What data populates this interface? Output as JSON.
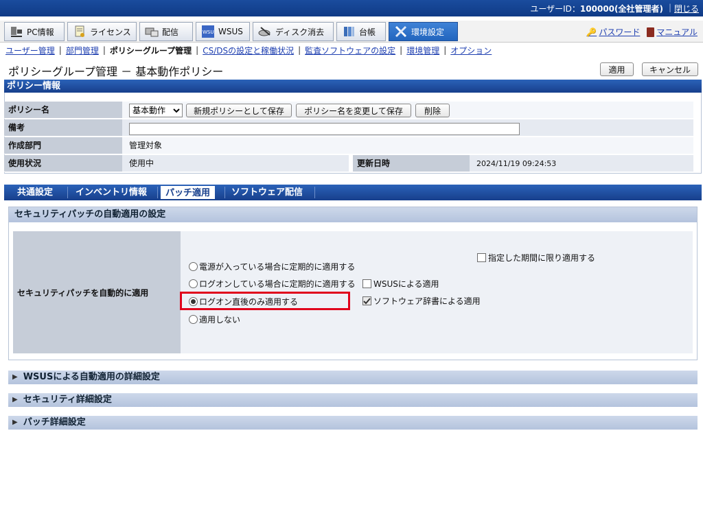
{
  "topbar": {
    "user_label": "ユーザーID：",
    "user_value": "100000(全社管理者)",
    "separator": "|",
    "logout": "閉じる"
  },
  "menu": {
    "tabs": [
      {
        "label": "PC情報",
        "icon": "pc-icon"
      },
      {
        "label": "ライセンス",
        "icon": "license-icon"
      },
      {
        "label": "配信",
        "icon": "delivery-icon"
      },
      {
        "label": "WSUS",
        "icon": "wsus-icon"
      },
      {
        "label": "ディスク消去",
        "icon": "disk-erase-icon"
      },
      {
        "label": "台帳",
        "icon": "ledger-icon"
      },
      {
        "label": "環境設定",
        "icon": "tools-icon"
      }
    ],
    "password": "パスワード",
    "manual": "マニュアル"
  },
  "subnav": {
    "items": [
      "ユーザー管理",
      "部門管理",
      "ポリシーグループ管理",
      "CS/DSの設定と稼働状況",
      "監査ソフトウェアの設定",
      "環境管理",
      "オプション"
    ],
    "separator": "|"
  },
  "page": {
    "title": "ポリシーグループ管理 － 基本動作ポリシー",
    "apply_button": "適用",
    "cancel_button": "キャンセル"
  },
  "policy_info": {
    "heading": "ポリシー情報",
    "name_label": "ポリシー名",
    "name_selected": "基本動作",
    "save_new": "新規ポリシーとして保存",
    "rename_save": "ポリシー名を変更して保存",
    "delete": "削除",
    "note_label": "備考",
    "note_value": "",
    "dept_label": "作成部門",
    "dept_value": "管理対象",
    "status_label": "使用状況",
    "status_value": "使用中",
    "updated_label": "更新日時",
    "updated_value": "2024/11/19 09:24:53"
  },
  "tabs": {
    "items": [
      "共通設定",
      "インベントリ情報",
      "パッチ適用",
      "ソフトウェア配信"
    ],
    "active": "パッチ適用"
  },
  "security_patch": {
    "heading": "セキュリティパッチの自動適用の設定",
    "row_label": "セキュリティパッチを自動的に適用",
    "radio_options": [
      "電源が入っている場合に定期的に適用する",
      "ログオンしている場合に定期的に適用する",
      "ログオン直後のみ適用する",
      "適用しない"
    ],
    "selected_radio": 2,
    "check_period": "指定した期間に限り適用する",
    "check_wsus": "WSUSによる適用",
    "check_dictionary": "ソフトウェア辞書による適用",
    "check_period_state": false,
    "check_wsus_state": false,
    "check_dictionary_state": true
  },
  "collapsible": [
    "WSUSによる自動適用の詳細設定",
    "セキュリティ詳細設定",
    "パッチ詳細設定"
  ]
}
